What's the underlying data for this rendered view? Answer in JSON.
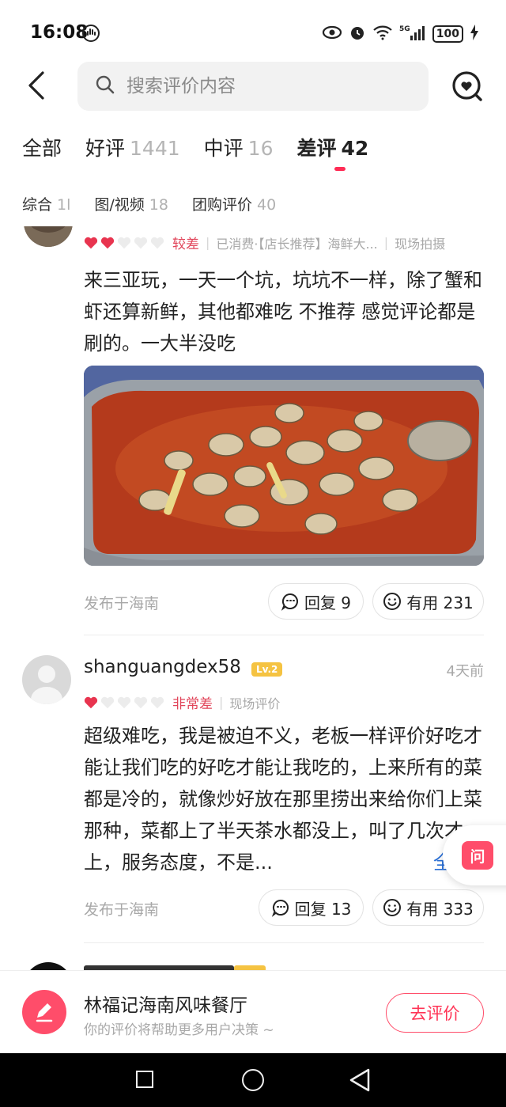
{
  "status_bar": {
    "time": "16:08",
    "battery": "100"
  },
  "search": {
    "placeholder": "搜索评价内容"
  },
  "tabs": [
    {
      "label": "全部",
      "count": ""
    },
    {
      "label": "好评",
      "count": "1441"
    },
    {
      "label": "中评",
      "count": "16"
    },
    {
      "label": "差评",
      "count": "42"
    }
  ],
  "filters": [
    {
      "label": "综合",
      "count": "1l"
    },
    {
      "label": "图/视频",
      "count": "18"
    },
    {
      "label": "团购评价",
      "count": "40"
    }
  ],
  "review1": {
    "rating_label": "较差",
    "hearts_filled": 2,
    "meta_consumed": "已消费·【店长推荐】海鲜大...",
    "meta_photo": "现场拍摄",
    "text": "来三亚玩，一天一个坑，坑坑不一样，除了蟹和虾还算新鲜，其他都难吃  不推荐  感觉评论都是刷的。一大半没吃",
    "location": "发布于海南",
    "reply": "回复 9",
    "useful": "有用 231"
  },
  "review2": {
    "username": "shanguangdex58",
    "level": "Lv.2",
    "time_ago": "4天前",
    "rating_label": "非常差",
    "hearts_filled": 1,
    "meta_tag": "现场评价",
    "text": "超级难吃，我是被迫不义，老板一样评价好吃才能让我们吃的好吃才能让我吃的，上来所有的菜都是冷的，就像炒好放在那里捞出来给你们上菜那种，菜都上了半天茶水都没上，叫了几次才上，服务态度，不是...",
    "more": "全",
    "location": "发布于海南",
    "reply": "回复 13",
    "useful": "有用 333"
  },
  "ask_badge": "问",
  "bottom_bar": {
    "restaurant_name": "林福记海南风味餐厅",
    "subtitle": "你的评价将帮助更多用户决策 ~",
    "review_button": "去评价"
  },
  "colors": {
    "accent": "#ff2c55",
    "heart": "#e8344f"
  }
}
